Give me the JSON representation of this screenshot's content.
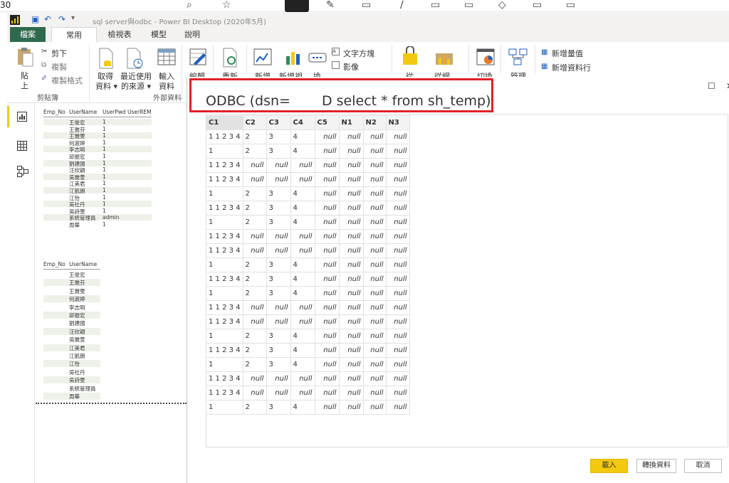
{
  "host": {
    "partial_text": "30"
  },
  "titlebar": {
    "title": "sql server與odbc - Power BI Desktop (2020年5月)"
  },
  "tabs": [
    "檔案",
    "常用",
    "檢視表",
    "模型",
    "說明"
  ],
  "ribbon": {
    "paste": "貼\n上",
    "paste_line1": "貼",
    "paste_line2": "上",
    "cut": "剪下",
    "copy": "複製",
    "format_painter": "複製格式",
    "clipboard_group": "剪貼簿",
    "get_data_1": "取得",
    "get_data_2": "資料",
    "recent_sources_1": "最近使用",
    "recent_sources_2": "的來源",
    "enter_data_1": "輸入",
    "enter_data_2": "資料",
    "external_data_group": "外部資料",
    "edit_partial": "編輯",
    "refresh_partial": "重新",
    "new_visual_partial": "新增",
    "new_visual2_partial": "新增視",
    "ask_partial": "換",
    "text_box": "文字方塊",
    "image": "影像",
    "from_partial": "從",
    "from2_partial": "從網",
    "switch_partial": "切換",
    "manage_partial": "管理",
    "new_measure": "新增量值",
    "new_column": "新增資料行"
  },
  "thumb1": {
    "headers": [
      "Emp_No",
      "UserName",
      "UserPwd",
      "UserREM"
    ],
    "names": [
      "王俊宏",
      "王雅芬",
      "王雅雯",
      "何淑婷",
      "李志明",
      "邱振宏",
      "劉建國",
      "汪欣穎",
      "吳雅萱",
      "江美君",
      "江凱朗",
      "江怡",
      "吳社丹",
      "吳詩雯",
      "系統管理員",
      "周華"
    ],
    "pwds": [
      "1",
      "1",
      "1",
      "1",
      "1",
      "1",
      "1",
      "1",
      "1",
      "1",
      "1",
      "1",
      "1",
      "1",
      "admin",
      "1"
    ]
  },
  "thumb2": {
    "headers": [
      "Emp_No",
      "UserName"
    ],
    "names": [
      "王俊宏",
      "王雅芬",
      "王雅雯",
      "何淑婷",
      "李志明",
      "邱振宏",
      "劉建國",
      "汪欣穎",
      "吳雅萱",
      "江美君",
      "江凱朗",
      "江怡",
      "吳社丹",
      "吳詩雯",
      "系統管理員",
      "周華"
    ]
  },
  "dialog": {
    "title": "ODBC (dsn=　 　D select * from sh_temp)",
    "columns": [
      "C1",
      "C2",
      "C3",
      "C4",
      "C5",
      "N1",
      "N2",
      "N3"
    ],
    "rows": [
      [
        "1 1 2 3 4",
        "2",
        "3",
        "4",
        "null",
        "null",
        "null",
        "null"
      ],
      [
        "1",
        "2",
        "3",
        "4",
        "null",
        "null",
        "null",
        "null"
      ],
      [
        "1 1 2 3 4",
        "null",
        "null",
        "null",
        "null",
        "null",
        "null",
        "null"
      ],
      [
        "1 1 2 3 4",
        "null",
        "null",
        "null",
        "null",
        "null",
        "null",
        "null"
      ],
      [
        "1",
        "2",
        "3",
        "4",
        "null",
        "null",
        "null",
        "null"
      ],
      [
        "1 1 2 3 4",
        "2",
        "3",
        "4",
        "null",
        "null",
        "null",
        "null"
      ],
      [
        "1",
        "2",
        "3",
        "4",
        "null",
        "null",
        "null",
        "null"
      ],
      [
        "1 1 2 3 4",
        "null",
        "null",
        "null",
        "null",
        "null",
        "null",
        "null"
      ],
      [
        "1 1 2 3 4",
        "null",
        "null",
        "null",
        "null",
        "null",
        "null",
        "null"
      ],
      [
        "1",
        "2",
        "3",
        "4",
        "null",
        "null",
        "null",
        "null"
      ],
      [
        "1 1 2 3 4",
        "2",
        "3",
        "4",
        "null",
        "null",
        "null",
        "null"
      ],
      [
        "1",
        "2",
        "3",
        "4",
        "null",
        "null",
        "null",
        "null"
      ],
      [
        "1 1 2 3 4",
        "null",
        "null",
        "null",
        "null",
        "null",
        "null",
        "null"
      ],
      [
        "1 1 2 3 4",
        "null",
        "null",
        "null",
        "null",
        "null",
        "null",
        "null"
      ],
      [
        "1",
        "2",
        "3",
        "4",
        "null",
        "null",
        "null",
        "null"
      ],
      [
        "1 1 2 3 4",
        "2",
        "3",
        "4",
        "null",
        "null",
        "null",
        "null"
      ],
      [
        "1",
        "2",
        "3",
        "4",
        "null",
        "null",
        "null",
        "null"
      ],
      [
        "1 1 2 3 4",
        "null",
        "null",
        "null",
        "null",
        "null",
        "null",
        "null"
      ],
      [
        "1 1 2 3 4",
        "null",
        "null",
        "null",
        "null",
        "null",
        "null",
        "null"
      ],
      [
        "1",
        "2",
        "3",
        "4",
        "null",
        "null",
        "null",
        "null"
      ]
    ],
    "load_button": "載入",
    "transform_button": "轉換資料",
    "cancel_button": "取消"
  },
  "colors": {
    "accent": "#f2c811",
    "file_tab": "#2f6a4f",
    "highlight_border": "#e0202a"
  }
}
